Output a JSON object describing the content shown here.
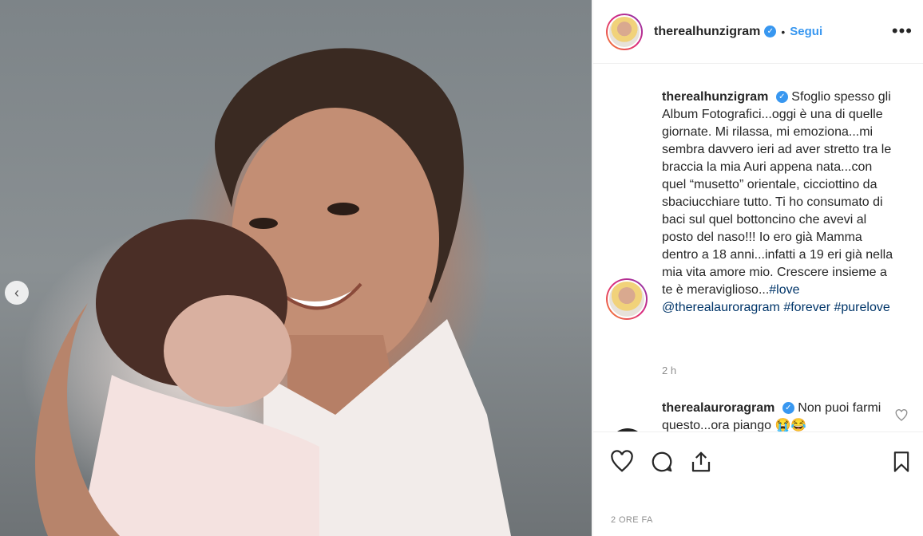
{
  "post": {
    "username": "therealhunzigram",
    "follow_label": "Segui",
    "dot": "•",
    "more_label": "•••",
    "verified_mark": "✓"
  },
  "caption": {
    "username": "therealhunzigram",
    "text": "Sfoglio spesso gli Album Fotografici...oggi è una di quelle giornate. Mi rilassa, mi emoziona...mi sembra davvero ieri ad aver stretto tra le braccia la mia Auri appena nata...con quel “musetto” orientale, cicciottino da sbaciucchiare tutto. Ti ho consumato di baci sul quel bottoncino che avevi al posto del naso!!! Io ero già Mamma dentro a 18 anni...infatti a 19 eri già nella mia vita amore mio. Crescere insieme a te è meraviglioso...",
    "tag1": "#love",
    "mention": "@therealauroragram",
    "tag2": "#forever",
    "tag3": "#purelove",
    "time": "2 h"
  },
  "comment": {
    "username": "therealauroragram",
    "text": "Non puoi farmi questo...ora piango 😭😂"
  },
  "footer": {
    "post_time": "2 ORE FA"
  },
  "icons": {
    "nav_prev": "‹"
  },
  "colors": {
    "link": "#3897f0",
    "hashtag": "#003569",
    "text": "#262626",
    "muted": "#8e8e8e"
  }
}
